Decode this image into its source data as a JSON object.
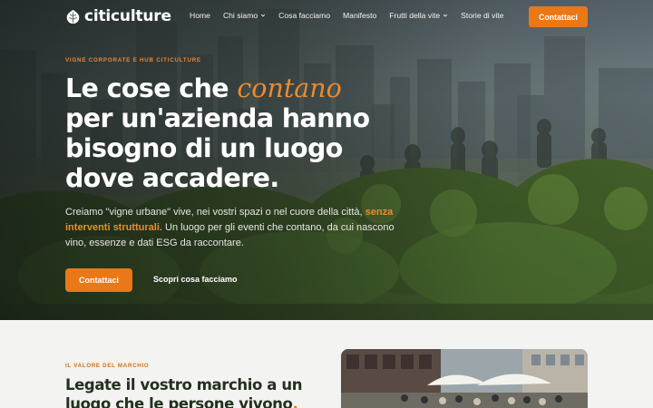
{
  "brand": {
    "name": "citiculture"
  },
  "nav": {
    "items": [
      {
        "label": "Home",
        "has_dropdown": false
      },
      {
        "label": "Chi siamo",
        "has_dropdown": true
      },
      {
        "label": "Cosa facciamo",
        "has_dropdown": false
      },
      {
        "label": "Manifesto",
        "has_dropdown": false
      },
      {
        "label": "Frutti della vite",
        "has_dropdown": true
      },
      {
        "label": "Storie di vite",
        "has_dropdown": false
      }
    ],
    "cta_label": "Contattaci"
  },
  "hero": {
    "eyebrow": "VIGNE CORPORATE E HUB CITICULTURE",
    "headline_before": "Le cose che ",
    "headline_accent": "contano",
    "headline_rest_1": "per un'azienda hanno",
    "headline_rest_2": "bisogno di un luogo",
    "headline_rest_3": "dove accadere.",
    "lede_before": "Creiamo \"vigne urbane\" vive, nei vostri spazi o nel cuore della città, ",
    "lede_highlight": "senza interventi strutturali",
    "lede_after": ". Un luogo per gli eventi che contano, da cui nascono vino, essenze e dati ESG da raccontare.",
    "primary_button": "Contattaci",
    "secondary_link": "Scopri cosa facciamo"
  },
  "value_section": {
    "eyebrow": "IL VALORE DEL MARCHIO",
    "title_line1": "Legate il vostro marchio a un",
    "title_line2": "luogo che le persone vivono",
    "title_dot": "."
  },
  "colors": {
    "accent": "#ea7817",
    "dark_green": "#23301f",
    "section_bg": "#f3f3f1"
  }
}
